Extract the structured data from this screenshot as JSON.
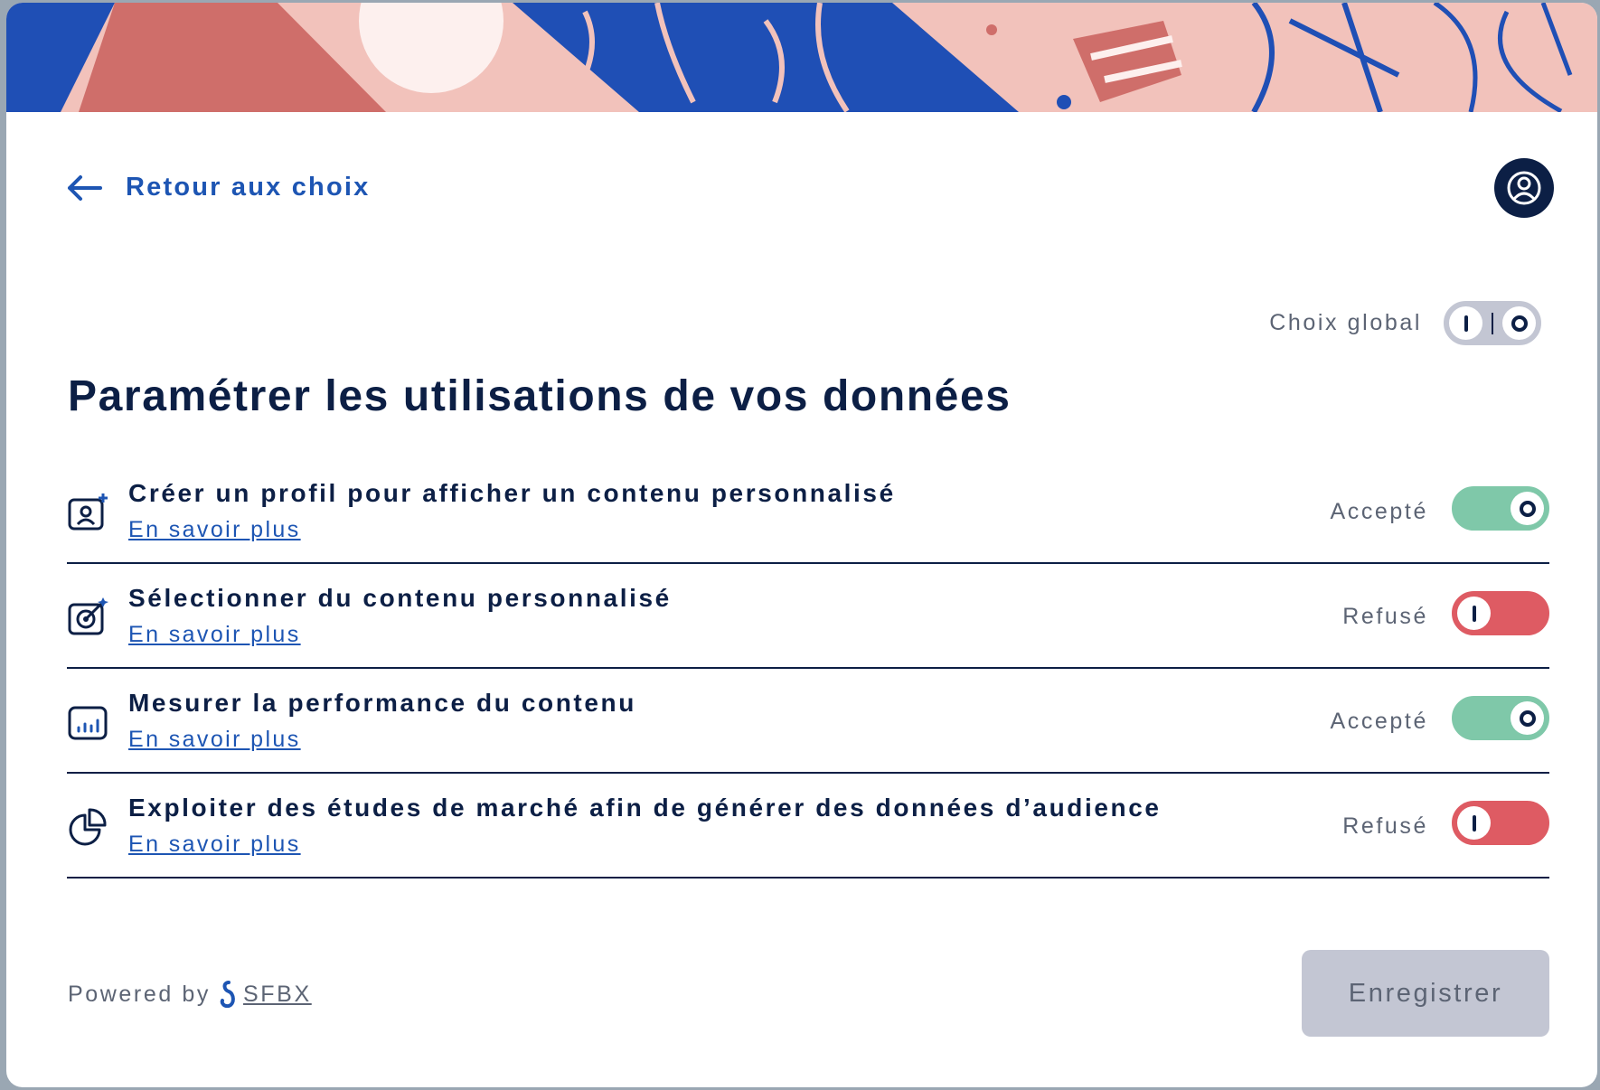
{
  "header": {
    "back_label": "Retour aux choix"
  },
  "global": {
    "label": "Choix global"
  },
  "title": "Paramétrer les utilisations de vos données",
  "purposes": [
    {
      "name": "Créer un profil pour afficher un contenu personnalisé",
      "link": "En savoir plus",
      "status": "Accepté",
      "enabled": true,
      "icon": "profile-add-icon"
    },
    {
      "name": "Sélectionner du contenu personnalisé",
      "link": "En savoir plus",
      "status": "Refusé",
      "enabled": false,
      "icon": "target-icon"
    },
    {
      "name": "Mesurer la performance du contenu",
      "link": "En savoir plus",
      "status": "Accepté",
      "enabled": true,
      "icon": "bar-chart-icon"
    },
    {
      "name": "Exploiter des études de marché afin de générer des données d’audience",
      "link": "En savoir plus",
      "status": "Refusé",
      "enabled": false,
      "icon": "pie-chart-icon"
    }
  ],
  "footer": {
    "powered_by": "Powered by",
    "brand": "SFBX",
    "save_label": "Enregistrer"
  },
  "colors": {
    "navy": "#0c1f45",
    "blue": "#1d55b3",
    "accepted": "#7fc8a9",
    "refused": "#de5b63",
    "disabled": "#c3c6d3"
  }
}
